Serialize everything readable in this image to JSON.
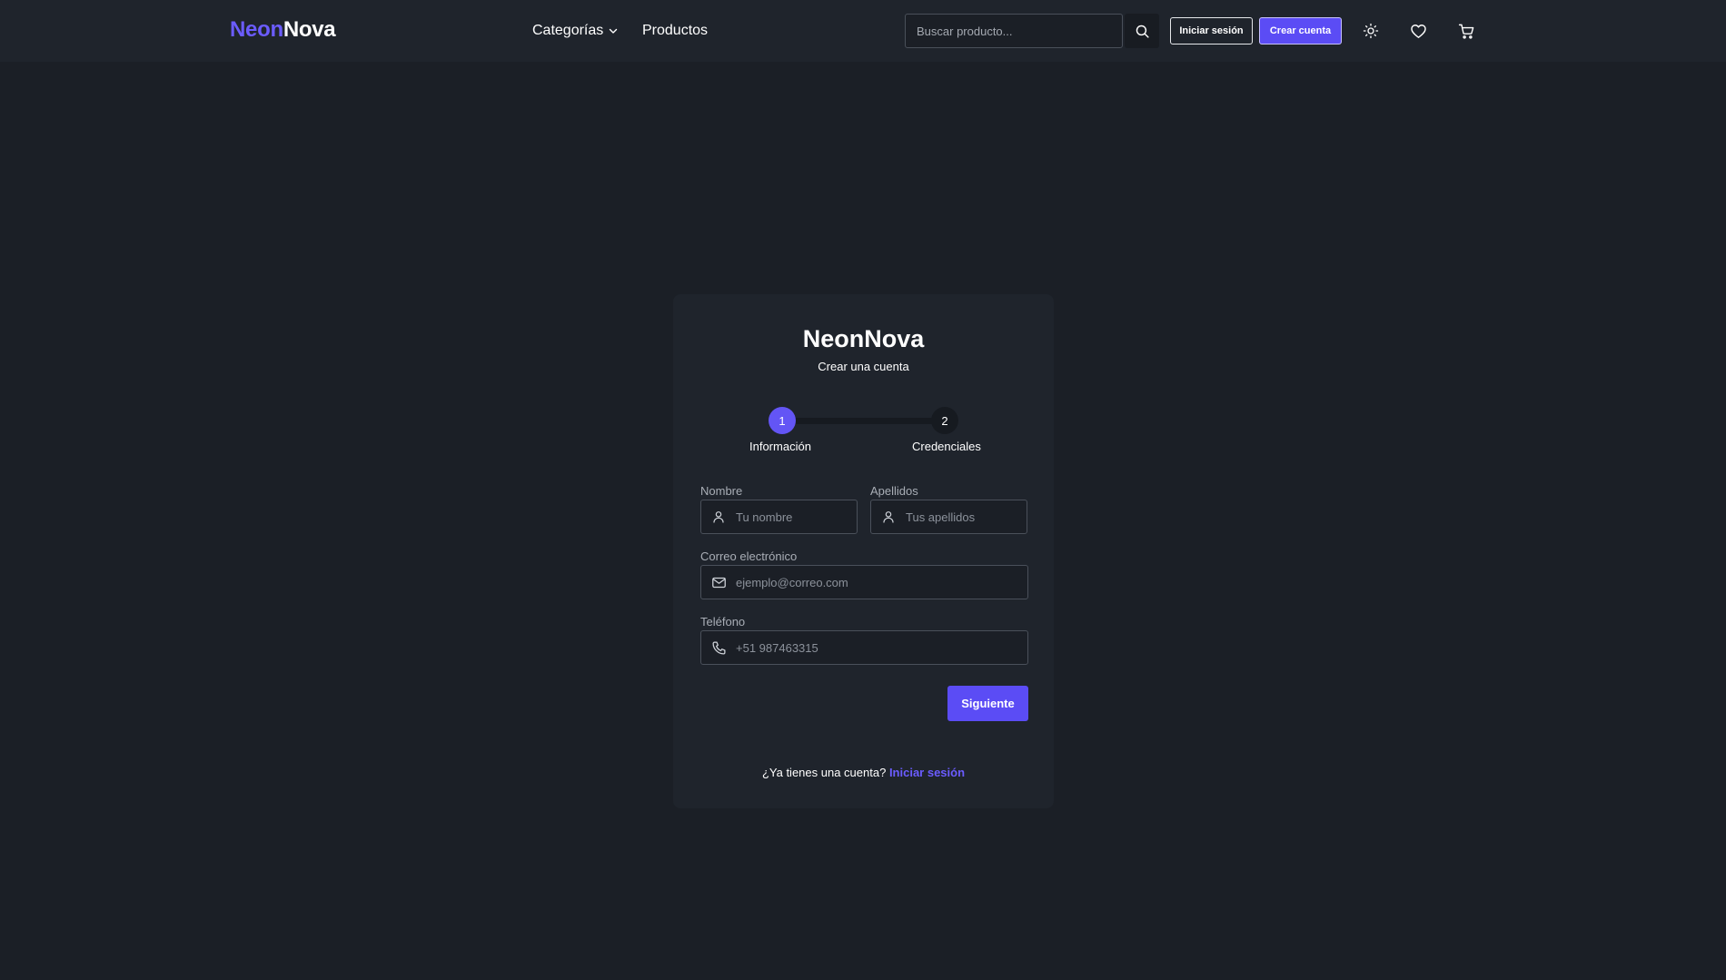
{
  "brand": {
    "part1": "Neon",
    "part2": "Nova"
  },
  "nav": {
    "categories_label": "Categorías",
    "products_label": "Productos"
  },
  "search": {
    "placeholder": "Buscar producto..."
  },
  "header_buttons": {
    "login_label": "Iniciar sesión",
    "signup_label": "Crear cuenta"
  },
  "icons": {
    "search": "search-icon",
    "theme": "sun-icon",
    "favorites": "heart-icon",
    "cart": "cart-icon",
    "chevron": "chevron-down-icon",
    "user": "user-icon",
    "mail": "mail-icon",
    "phone": "phone-icon"
  },
  "colors": {
    "accent": "#5b4cf5",
    "brand_accent": "#6b5cff",
    "background": "#1b1f26",
    "card": "#1f242c"
  },
  "card": {
    "title": "NeonNova",
    "subtitle": "Crear una cuenta",
    "steps": [
      {
        "number": "1",
        "label": "Información",
        "active": true
      },
      {
        "number": "2",
        "label": "Credenciales",
        "active": false
      }
    ],
    "fields": {
      "first_name": {
        "label": "Nombre",
        "placeholder": "Tu nombre",
        "value": ""
      },
      "last_name": {
        "label": "Apellidos",
        "placeholder": "Tus apellidos",
        "value": ""
      },
      "email": {
        "label": "Correo electrónico",
        "placeholder": "ejemplo@correo.com",
        "value": ""
      },
      "phone": {
        "label": "Teléfono",
        "placeholder": "+51 987463315",
        "value": ""
      }
    },
    "next_button": "Siguiente",
    "footer": {
      "prompt": "¿Ya tienes una cuenta?",
      "link": "Iniciar sesión"
    }
  }
}
